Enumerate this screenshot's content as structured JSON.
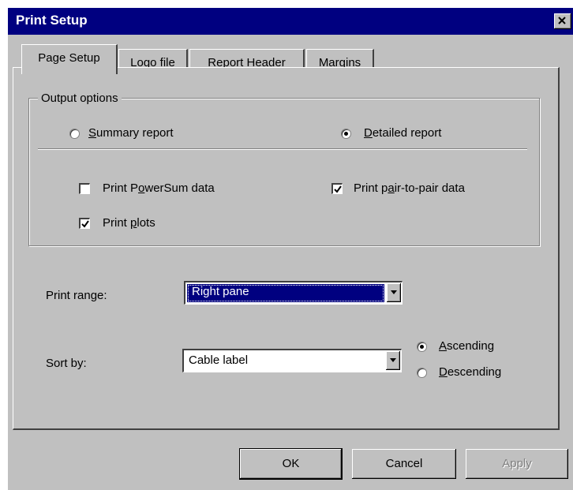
{
  "window": {
    "title": "Print Setup",
    "colors": {
      "titlebar": "#000080",
      "face": "#c0c0c0",
      "selection": "#000080"
    }
  },
  "tabs": [
    {
      "label": "Page Setup",
      "active": true
    },
    {
      "label": "Logo file",
      "active": false
    },
    {
      "label": "Report Header",
      "active": false
    },
    {
      "label": "Margins",
      "active": false
    }
  ],
  "output_options": {
    "group_label": "Output options",
    "report_type": [
      {
        "prefix": "",
        "mnemonic": "S",
        "rest": "ummary report",
        "selected": false
      },
      {
        "prefix": "",
        "mnemonic": "D",
        "rest": "etailed report",
        "selected": true
      }
    ],
    "checkboxes": [
      {
        "prefix": "Print P",
        "mnemonic": "o",
        "rest": "werSum data",
        "checked": false
      },
      {
        "prefix": "Print p",
        "mnemonic": "a",
        "rest": "ir-to-pair data",
        "checked": true
      },
      {
        "prefix": "Print ",
        "mnemonic": "p",
        "rest": "lots",
        "checked": true
      }
    ]
  },
  "print_range": {
    "label": "Print range:",
    "value": "Right pane"
  },
  "sort_by": {
    "label": "Sort by:",
    "value": "Cable label",
    "order": [
      {
        "prefix": "",
        "mnemonic": "A",
        "rest": "scending",
        "selected": true
      },
      {
        "prefix": "",
        "mnemonic": "D",
        "rest": "escending",
        "selected": false
      }
    ]
  },
  "buttons": {
    "ok": "OK",
    "cancel": "Cancel",
    "apply": "Apply"
  },
  "icons": {
    "close": "close-icon",
    "dropdown": "chevron-down-icon",
    "check": "checkmark-icon"
  }
}
